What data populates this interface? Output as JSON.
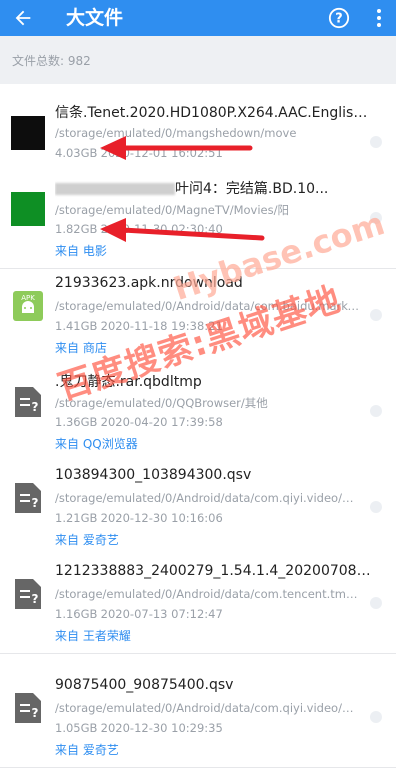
{
  "header": {
    "title": "大文件",
    "back_icon": "back-arrow-icon",
    "help_icon": "help-icon",
    "more_icon": "more-vert-icon"
  },
  "summary": {
    "label": "文件总数: 982"
  },
  "files": [
    {
      "name": "信条.Tenet.2020.HD1080P.X264.AAC.English.C...",
      "path": "/storage/emulated/0/mangshedown/move",
      "size": "4.03GB",
      "date": "2020-12-01 16:02:51",
      "source": "",
      "thumb": "video-black"
    },
    {
      "name": "叶问4：完结篇.BD.10...",
      "path": "/storage/emulated/0/MagneTV/Movies/阳",
      "size": "1.82GB",
      "date": "2020-11-30 02:30:40",
      "source": "来自  电影",
      "thumb": "video-green"
    },
    {
      "name": "21933623.apk.nrdownload",
      "path": "/storage/emulated/0/Android/data/com.baidu.market...",
      "size": "1.41GB",
      "date": "2020-11-18 19:38:21",
      "source": "来自  商店",
      "thumb": "apk"
    },
    {
      "name": ".鬼刀静态.rar.qbdltmp",
      "path": "/storage/emulated/0/QQBrowser/其他",
      "size": "1.36GB",
      "date": "2020-04-20 17:39:58",
      "source": "来自  QQ浏览器",
      "thumb": "unknown"
    },
    {
      "name": "103894300_103894300.qsv",
      "path": "/storage/emulated/0/Android/data/com.qiyi.video/file...",
      "size": "1.21GB",
      "date": "2020-12-30 10:16:06",
      "source": "来自  爱奇艺",
      "thumb": "unknown"
    },
    {
      "name": "1212338883_2400279_1.54.1.4_20200708162...",
      "path": "/storage/emulated/0/Android/data/com.tencent.tmgp...",
      "size": "1.16GB",
      "date": "2020-07-13 07:12:47",
      "source": "来自  王者荣耀",
      "thumb": "unknown"
    },
    {
      "name": "90875400_90875400.qsv",
      "path": "/storage/emulated/0/Android/data/com.qiyi.video/file...",
      "size": "1.05GB",
      "date": "2020-12-30 10:29:35",
      "source": "来自  爱奇艺",
      "thumb": "unknown"
    }
  ],
  "watermark": {
    "line1": "百度搜索:黑域基地",
    "line2": "Hybase.com"
  },
  "colors": {
    "accent": "#2f8ef0",
    "arrow": "#e8202a"
  }
}
